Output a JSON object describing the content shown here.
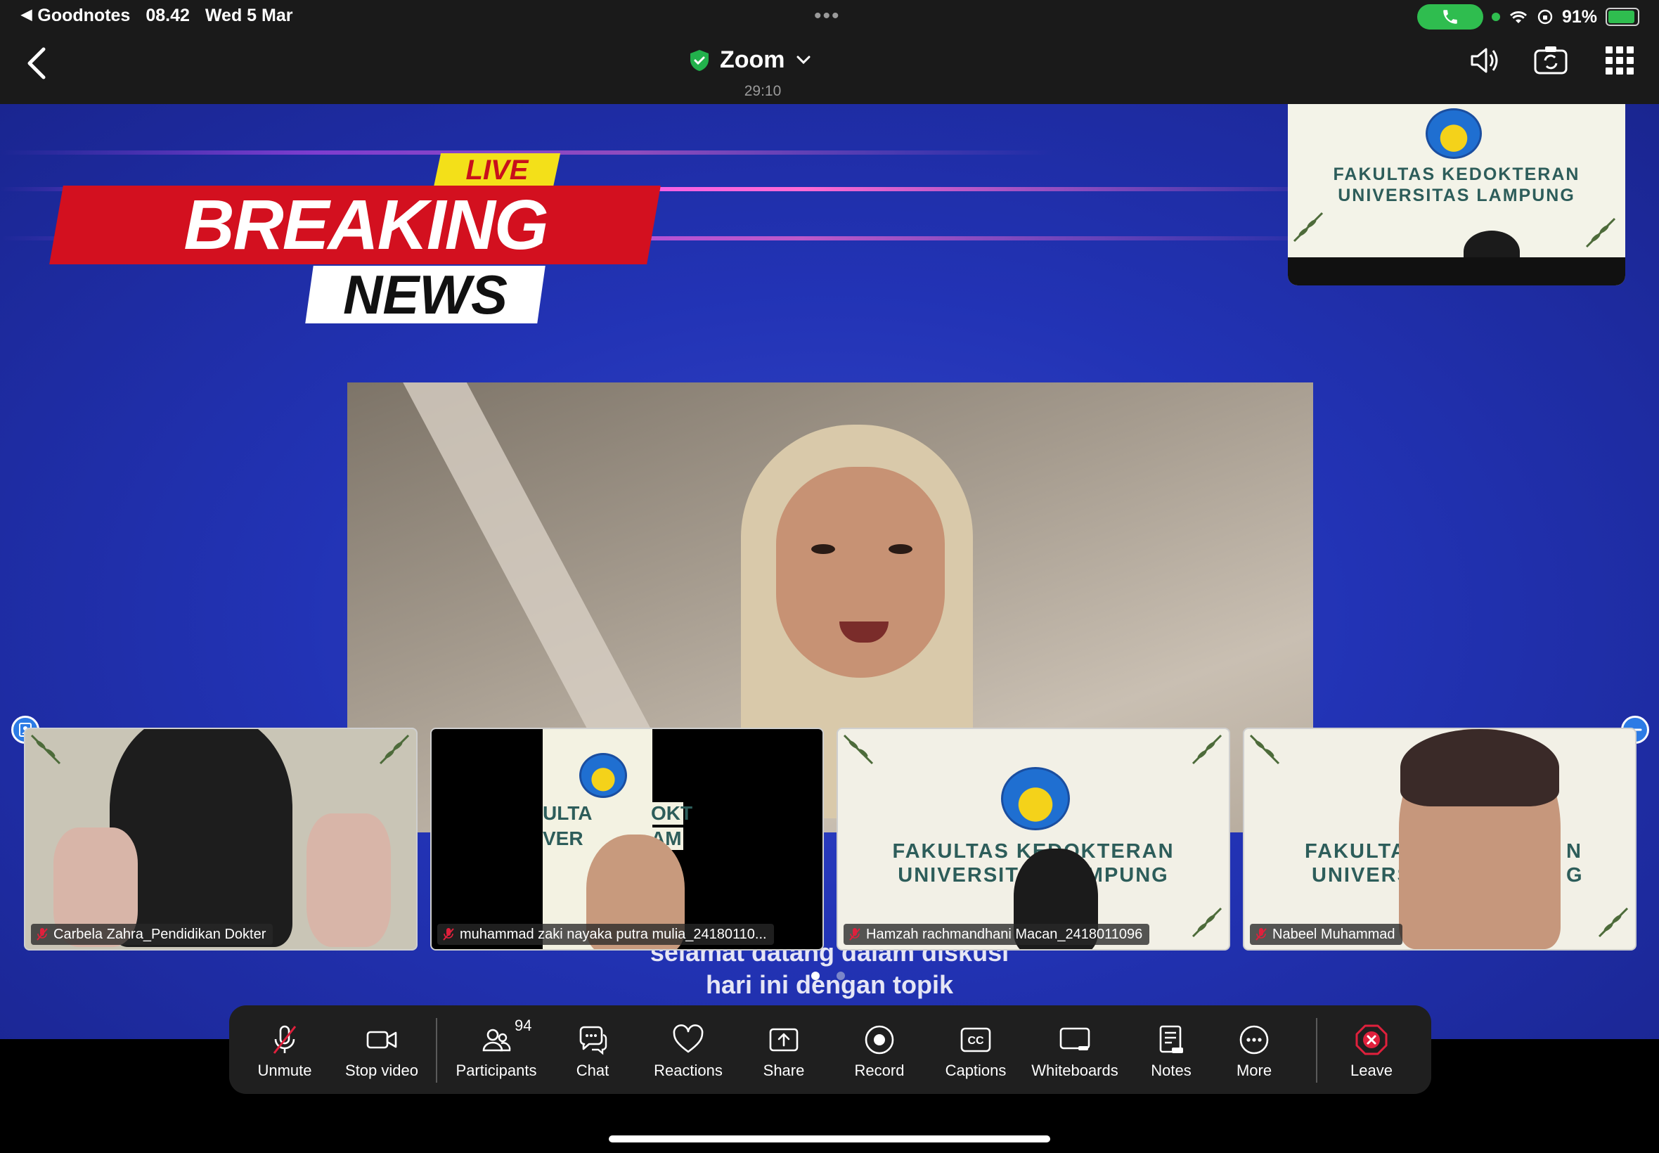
{
  "status_bar": {
    "app_back": "Goodnotes",
    "time": "08.42",
    "date": "Wed 5 Mar",
    "battery": "91%"
  },
  "header": {
    "title": "Zoom",
    "timer": "29:10"
  },
  "background": {
    "live_label": "LIVE",
    "breaking_label": "BREAKING",
    "news_label": "NEWS"
  },
  "self_view": {
    "line1": "FAKULTAS KEDOKTERAN",
    "line2": "UNIVERSITAS LAMPUNG"
  },
  "tiles": [
    {
      "name": "Carbela Zahra_Pendidikan Dokter"
    },
    {
      "name": "muhammad zaki nayaka putra mulia_24180110...",
      "bg1": "ULTA",
      "bg2": "VER",
      "bg3": "OKT",
      "bg4": "AM"
    },
    {
      "name": "Hamzah rachmandhani Macan_2418011096",
      "bg1": "FAKULTAS KEDOKTERAN",
      "bg2": "UNIVERSITAS LAMPUNG"
    },
    {
      "name": "Nabeel Muhammad",
      "bg1": "FAKULTAS",
      "bg2": "UNIVERSI",
      "bg3": "N",
      "bg4": "G"
    }
  ],
  "captions": {
    "line1": "selamat datang dalam diskusi",
    "line2": "hari ini dengan topik"
  },
  "toolbar": {
    "unmute": "Unmute",
    "stop_video": "Stop video",
    "participants": "Participants",
    "participants_count": "94",
    "chat": "Chat",
    "reactions": "Reactions",
    "share": "Share",
    "record": "Record",
    "captions": "Captions",
    "whiteboards": "Whiteboards",
    "notes": "Notes",
    "more": "More",
    "leave": "Leave"
  },
  "colors": {
    "accent_blue": "#2c7be5",
    "leave_red": "#e0203c",
    "call_green": "#2fbd4f"
  }
}
